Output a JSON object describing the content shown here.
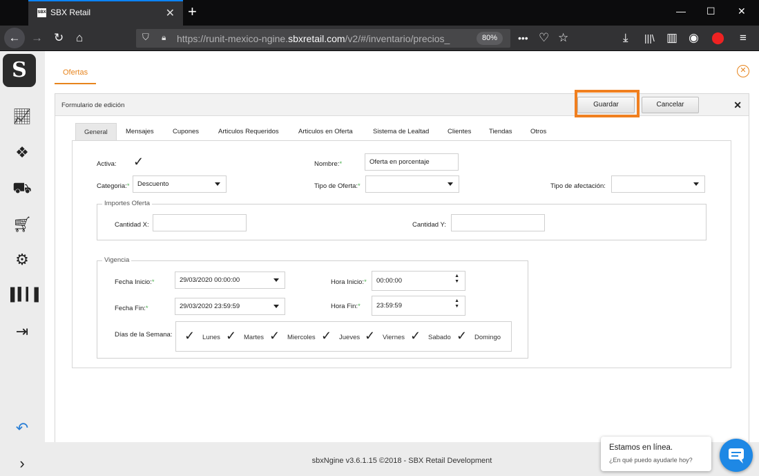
{
  "browser": {
    "tab_title": "SBX Retail",
    "tab_favicon": "SBX",
    "url_prefix": "https://runit-mexico-ngine.",
    "url_domain": "sbxretail.com",
    "url_rest": "/v2/#/inventario/precios_",
    "zoom": "80%"
  },
  "app": {
    "logo": "S",
    "page_tab": "Ofertas"
  },
  "form": {
    "title": "Formulario de edición",
    "save_label": "Guardar",
    "cancel_label": "Cancelar",
    "tabs": [
      "General",
      "Mensajes",
      "Cupones",
      "Articulos Requeridos",
      "Articulos en Oferta",
      "Sistema de Lealtad",
      "Clientes",
      "Tiendas",
      "Otros"
    ],
    "activa_label": "Activa:",
    "nombre_label": "Nombre:",
    "nombre_value": "Oferta en porcentaje",
    "categoria_label": "Categoria:",
    "categoria_value": "Descuento",
    "tipo_oferta_label": "Tipo de Oferta:",
    "tipo_oferta_value": "",
    "tipo_afectacion_label": "Tipo de afectación:",
    "tipo_afectacion_value": "",
    "importes_legend": "Importes Oferta",
    "cantidad_x_label": "Cantidad X:",
    "cantidad_y_label": "Cantidad Y:",
    "vigencia_legend": "Vigencia",
    "fecha_inicio_label": "Fecha Inicio:",
    "fecha_inicio_value": "29/03/2020 00:00:00",
    "hora_inicio_label": "Hora Inicio:",
    "hora_inicio_value": "00:00:00",
    "fecha_fin_label": "Fecha Fin:",
    "fecha_fin_value": "29/03/2020 23:59:59",
    "hora_fin_label": "Hora Fin:",
    "hora_fin_value": "23:59:59",
    "dias_label": "Días de la Semana:",
    "days": [
      "Lunes",
      "Martes",
      "Miercoles",
      "Jueves",
      "Viernes",
      "Sabado",
      "Domingo"
    ],
    "req_mark": "*"
  },
  "footer": {
    "text": "sbxNgine v3.6.1.15 ©2018 - SBX Retail Development"
  },
  "chat": {
    "title": "Estamos en línea.",
    "subtitle": "¿En qué puedo ayudarle hoy?"
  },
  "colors": {
    "accent": "#e7841c",
    "highlight": "#f07f1f",
    "required": "#4caf50",
    "chat": "#1e88e5"
  }
}
